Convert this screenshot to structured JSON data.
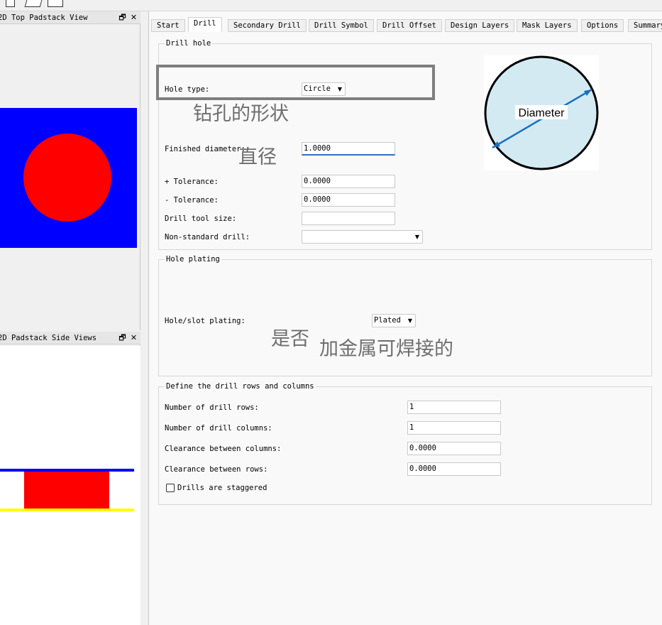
{
  "toolbar": {
    "icons": [
      "new-file-icon",
      "open-folder-icon",
      "save-icon"
    ]
  },
  "top_view": {
    "title": "2D Top Padstack View",
    "colors": {
      "pad": "#0000ff",
      "hole": "#ff0000"
    }
  },
  "side_view": {
    "title": "2D Padstack Side Views",
    "colors": {
      "top_layer": "#0000ff",
      "drill": "#ff0000",
      "bottom_layer": "#ffff00"
    }
  },
  "tabs": [
    {
      "label": "Start",
      "active": false
    },
    {
      "label": "Drill",
      "active": true
    },
    {
      "label": "Secondary Drill",
      "active": false
    },
    {
      "label": "Drill Symbol",
      "active": false
    },
    {
      "label": "Drill Offset",
      "active": false
    },
    {
      "label": "Design Layers",
      "active": false
    },
    {
      "label": "Mask Layers",
      "active": false
    },
    {
      "label": "Options",
      "active": false
    },
    {
      "label": "Summary",
      "active": false
    }
  ],
  "drill_hole": {
    "title": "Drill hole",
    "hole_type_label": "Hole type:",
    "hole_type_value": "Circle",
    "finished_diameter_label": "Finished diameter:",
    "finished_diameter_value": "1.0000",
    "plus_tolerance_label": "+ Tolerance:",
    "plus_tolerance_value": "0.0000",
    "minus_tolerance_label": "- Tolerance:",
    "minus_tolerance_value": "0.0000",
    "drill_tool_size_label": "Drill tool size:",
    "drill_tool_size_value": "",
    "non_standard_label": "Non-standard drill:",
    "non_standard_value": "",
    "diagram_label": "Diameter"
  },
  "hole_plating": {
    "title": "Hole plating",
    "label": "Hole/slot plating:",
    "value": "Plated"
  },
  "rows_cols": {
    "title": "Define the drill rows and columns",
    "rows_label": "Number of drill rows:",
    "rows_value": "1",
    "cols_label": "Number of drill columns:",
    "cols_value": "1",
    "clear_cols_label": "Clearance between columns:",
    "clear_cols_value": "0.0000",
    "clear_rows_label": "Clearance between rows:",
    "clear_rows_value": "0.0000",
    "staggered_label": "Drills are staggered",
    "staggered_checked": false
  },
  "annotations": {
    "hole_shape": "钻孔的形状",
    "diameter": "直径",
    "plating_yes_no": "是否",
    "metal_solderable": "加金属可焊接的"
  }
}
